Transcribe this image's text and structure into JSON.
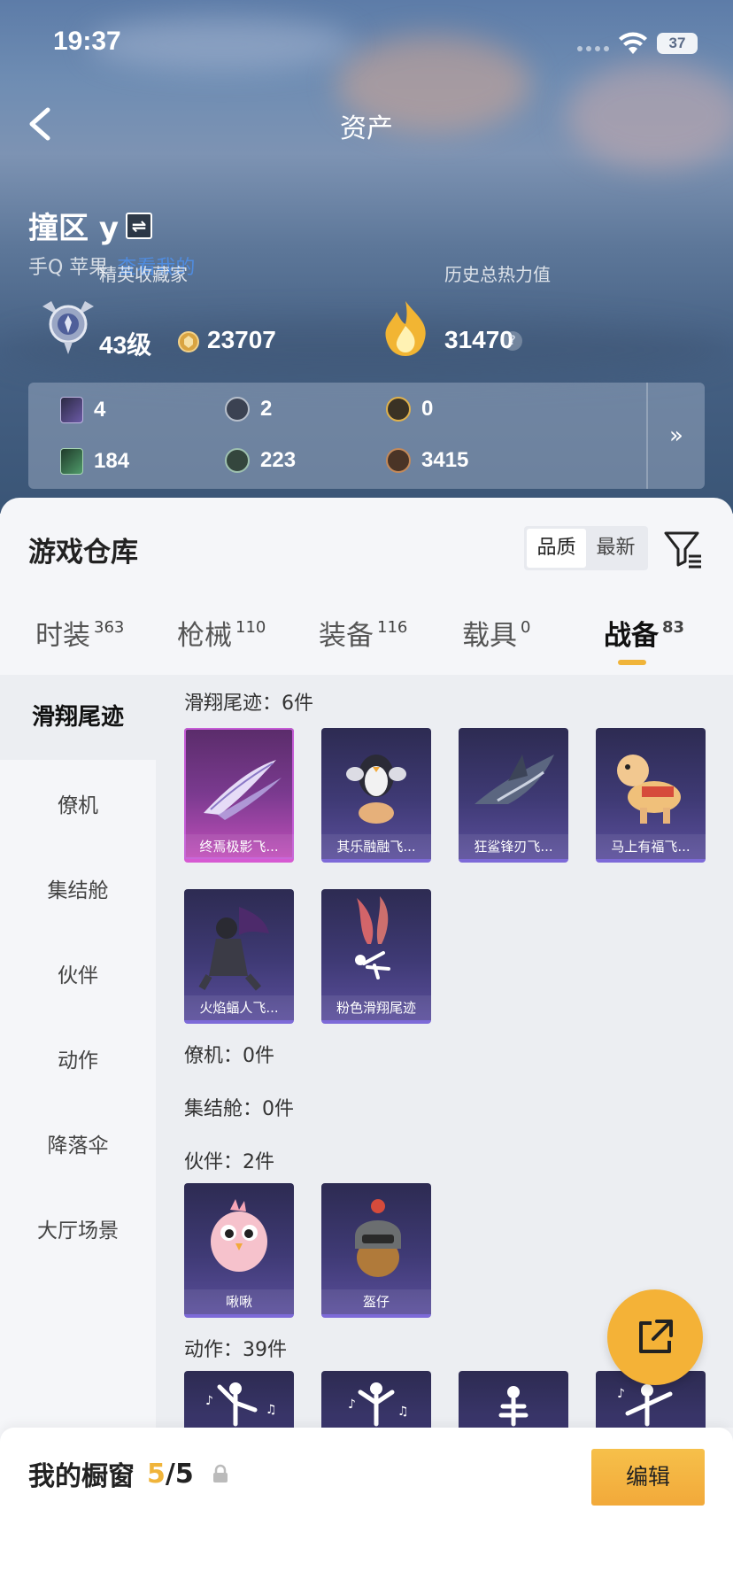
{
  "status_bar": {
    "time": "19:37",
    "battery": "37"
  },
  "header": {
    "title": "资产"
  },
  "profile": {
    "name": "撞区 y",
    "swap_glyph": "⇌",
    "platform": "手Q 苹果",
    "link": "查看我的",
    "collector_title": "精英收藏家",
    "level": "43级",
    "coins": "23707",
    "heat_label": "历史总热力值",
    "heat_value": "31470",
    "heat_help": "?"
  },
  "stats": [
    {
      "icon": "card-purple-icon",
      "value": "4"
    },
    {
      "icon": "badge-grey-icon",
      "value": "2"
    },
    {
      "icon": "badge-gold-icon",
      "value": "0"
    },
    {
      "icon": "card-green-icon",
      "value": "184"
    },
    {
      "icon": "badge-green-icon",
      "value": "223"
    },
    {
      "icon": "badge-bronze-icon",
      "value": "3415"
    }
  ],
  "stats_more": "»",
  "warehouse": {
    "title": "游戏仓库",
    "sort": [
      "品质",
      "最新"
    ],
    "active_sort": "品质",
    "tabs": [
      {
        "label": "时装",
        "count": "363"
      },
      {
        "label": "枪械",
        "count": "110"
      },
      {
        "label": "装备",
        "count": "116"
      },
      {
        "label": "载具",
        "count": "0"
      },
      {
        "label": "战备",
        "count": "83"
      }
    ],
    "active_tab": "战备"
  },
  "sidebar": [
    "滑翔尾迹",
    "僚机",
    "集结舱",
    "伙伴",
    "动作",
    "降落伞",
    "大厅场景"
  ],
  "sidebar_active": "滑翔尾迹",
  "sections": {
    "trail": {
      "header": "滑翔尾迹：6件",
      "items": [
        "终焉极影飞...",
        "其乐融融飞...",
        "狂鲨锋刃飞...",
        "马上有福飞...",
        "火焰蝠人飞...",
        "粉色滑翔尾迹"
      ]
    },
    "wingman": {
      "header": "僚机：0件"
    },
    "pod": {
      "header": "集结舱：0件"
    },
    "buddy": {
      "header": "伙伴：2件",
      "items": [
        "啾啾",
        "盔仔"
      ]
    },
    "emote": {
      "header": "动作：39件"
    }
  },
  "bottom": {
    "title": "我的橱窗",
    "count": "5",
    "total": "/5",
    "edit": "编辑"
  },
  "colors": {
    "accent": "#f0b43a",
    "card": "#3f3a75",
    "pink_card": "#c14fba"
  }
}
